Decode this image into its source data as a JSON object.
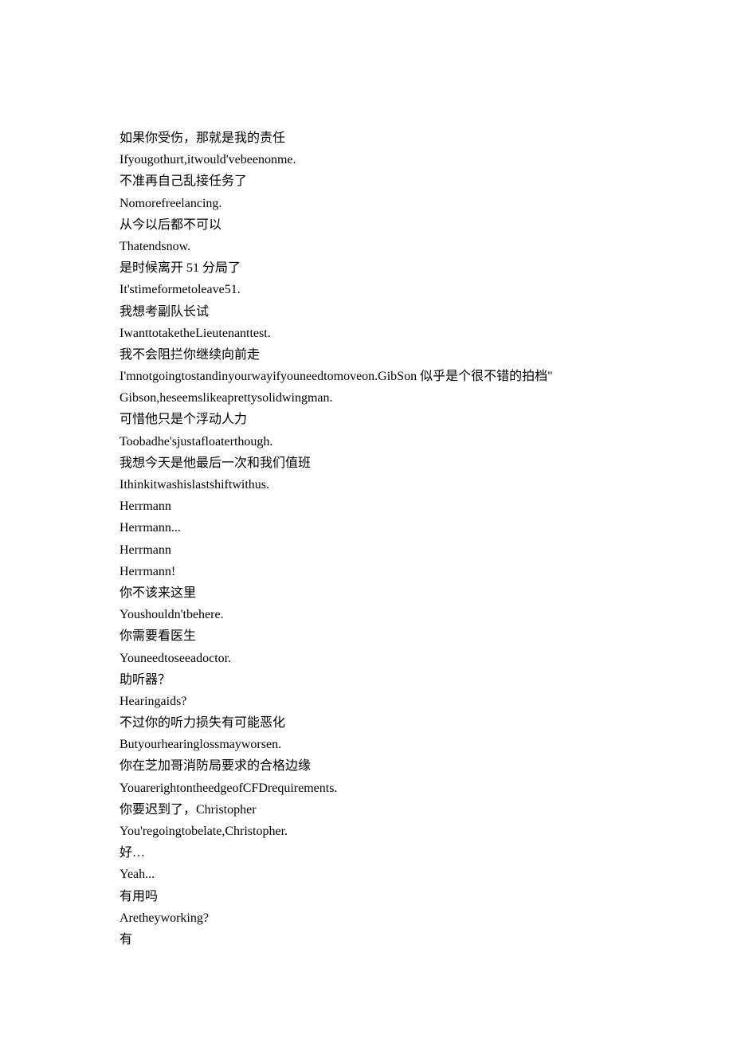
{
  "lines": [
    "如果你受伤，那就是我的责任",
    "Ifyougothurt,itwould'vebeenonme.",
    "不准再自己乱接任务了",
    "Nomorefreelancing.",
    "从今以后都不可以",
    "Thatendsnow.",
    "是时候离开 51 分局了",
    "It'stimeformetoleave51.",
    "我想考副队长试",
    "IwanttotaketheLieutenanttest.",
    "我不会阻拦你继续向前走",
    "I'mnotgoingtostandinyourwayifyouneedtomoveon.GibSon 似乎是个很不错的拍档\"",
    "Gibson,heseemslikeaprettysolidwingman.",
    "可惜他只是个浮动人力",
    "Toobadhe'sjustafloaterthough.",
    "我想今天是他最后一次和我们值班",
    "Ithinkitwashislastshiftwithus.",
    "Herrmann",
    "Herrmann...",
    "Herrmann",
    "Herrmann!",
    "你不该来这里",
    "Youshouldn'tbehere.",
    "你需要看医生",
    "Youneedtoseeadoctor.",
    "助听器？",
    "Hearingaids?",
    "不过你的听力损失有可能恶化",
    "Butyourhearinglossmayworsen.",
    "你在芝加哥消防局要求的合格边缘",
    "YouarerightontheedgeofCFDrequirements.",
    "你要迟到了，Christopher",
    "You'regoingtobelate,Christopher.",
    "好…",
    "Yeah...",
    "有用吗",
    "Aretheyworking?",
    "有"
  ]
}
